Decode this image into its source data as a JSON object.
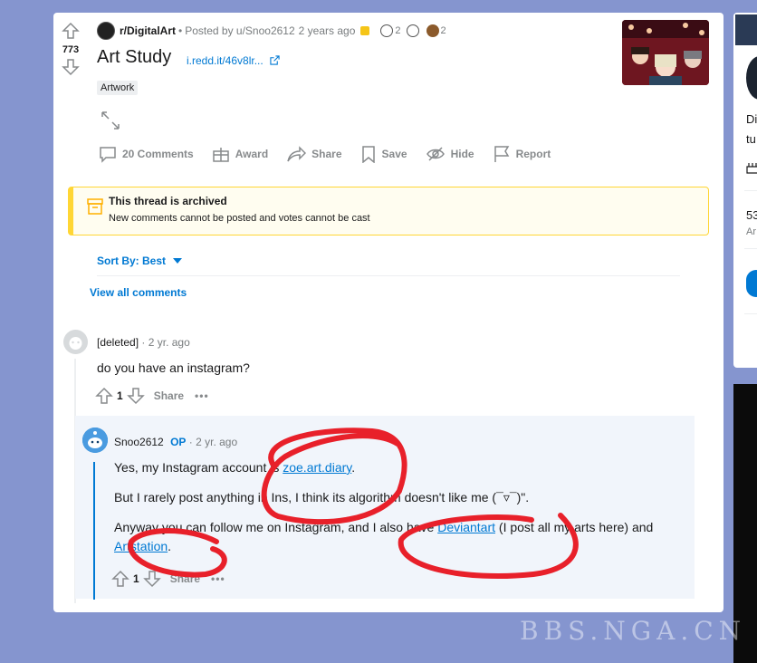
{
  "post": {
    "score": "773",
    "subreddit": "r/DigitalArt",
    "posted_by": "Posted by u/Snoo2612",
    "age": "2 years ago",
    "award_counts": [
      "2",
      "2"
    ],
    "title": "Art Study",
    "domain": "i.redd.it/46v8lr...",
    "flair": "Artwork"
  },
  "actions": {
    "comments": "20 Comments",
    "award": "Award",
    "share": "Share",
    "save": "Save",
    "hide": "Hide",
    "report": "Report"
  },
  "archive": {
    "title": "This thread is archived",
    "message": "New comments cannot be posted and votes cannot be cast"
  },
  "sort": {
    "label": "Sort By: Best"
  },
  "view_all": "View all comments",
  "comments": [
    {
      "author": "[deleted]",
      "age": "2 yr. ago",
      "body": "do you have an instagram?",
      "score": "1",
      "share": "Share",
      "more": "•••"
    },
    {
      "author": "Snoo2612",
      "op": "OP",
      "age": "2 yr. ago",
      "p1_pre": "Yes, my Instagram account is ",
      "p1_link": "zoe.art.diary",
      "p1_post": ".",
      "p2": "But I rarely post anything in Ins, I think its algorithm doesn't like me (¯▿¯)\".",
      "p3_pre": "Anyway you can follow me on Instagram, and I also have ",
      "p3_link1": "Deviantart",
      "p3_mid": " (I post all my arts here) and ",
      "p3_link2": "Artstation",
      "p3_post": ".",
      "score": "1",
      "share": "Share",
      "more": "•••"
    }
  ],
  "right_panel": {
    "text1": "Di",
    "text2": "tu",
    "stat": "53",
    "stat_label": "Ar"
  },
  "watermark": "BBS.NGA.CN",
  "colors": {
    "accent": "#0079d3",
    "archive_border": "#ffd635",
    "scribble": "#e8202a",
    "background": "#8595cf"
  }
}
